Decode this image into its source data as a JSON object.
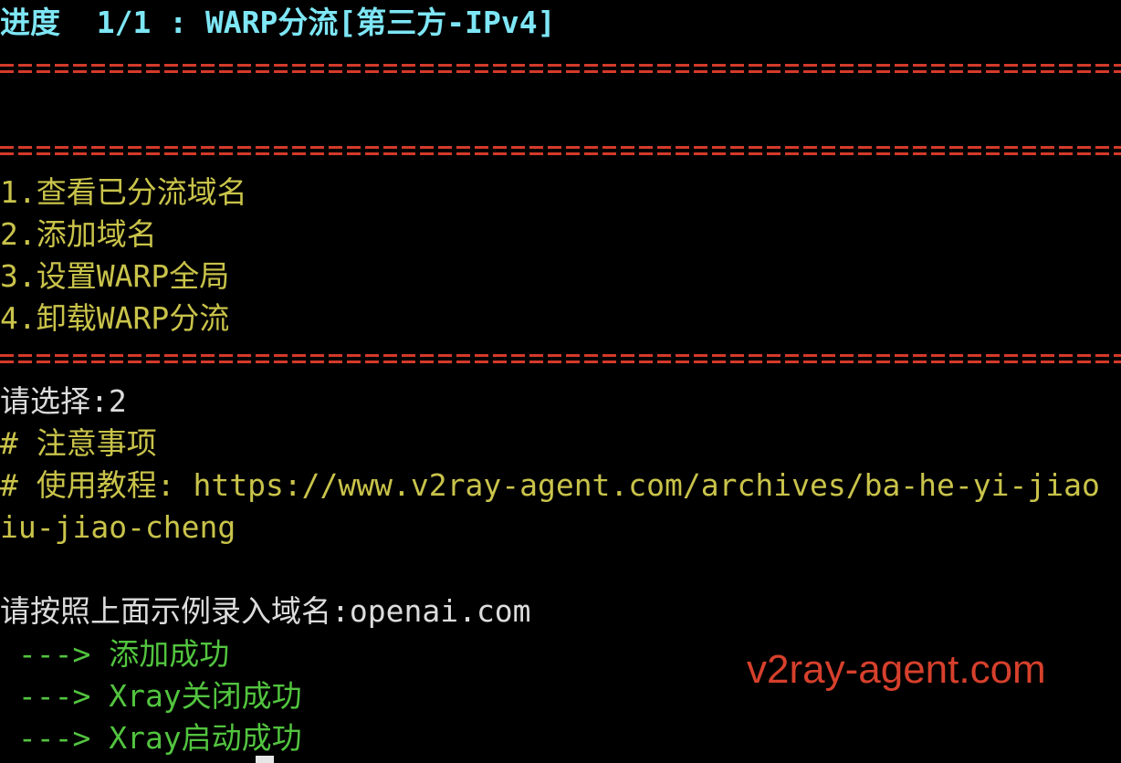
{
  "terminal": {
    "progress_line": "进度  1/1 : WARP分流[第三方-IPv4]",
    "menu_items": [
      "1.查看已分流域名",
      "2.添加域名",
      "3.设置WARP全局",
      "4.卸载WARP分流"
    ],
    "prompt_select": "请选择:2",
    "note_header": "# 注意事项",
    "note_tutorial": "# 使用教程: https://www.v2ray-agent.com/archives/ba-he-yi-jiao",
    "note_tutorial_cont": "iu-jiao-cheng",
    "prompt_domain": "请按照上面示例录入域名:openai.com",
    "results": [
      " ---> 添加成功",
      " ---> Xray关闭成功",
      " ---> Xray启动成功"
    ]
  },
  "watermark": "v2ray-agent.com",
  "colors": {
    "background": "#000000",
    "title": "#7ee6f5",
    "menu": "#c9c34a",
    "rule": "#d43a2a",
    "success": "#52c43f",
    "watermark": "#d6402c"
  }
}
